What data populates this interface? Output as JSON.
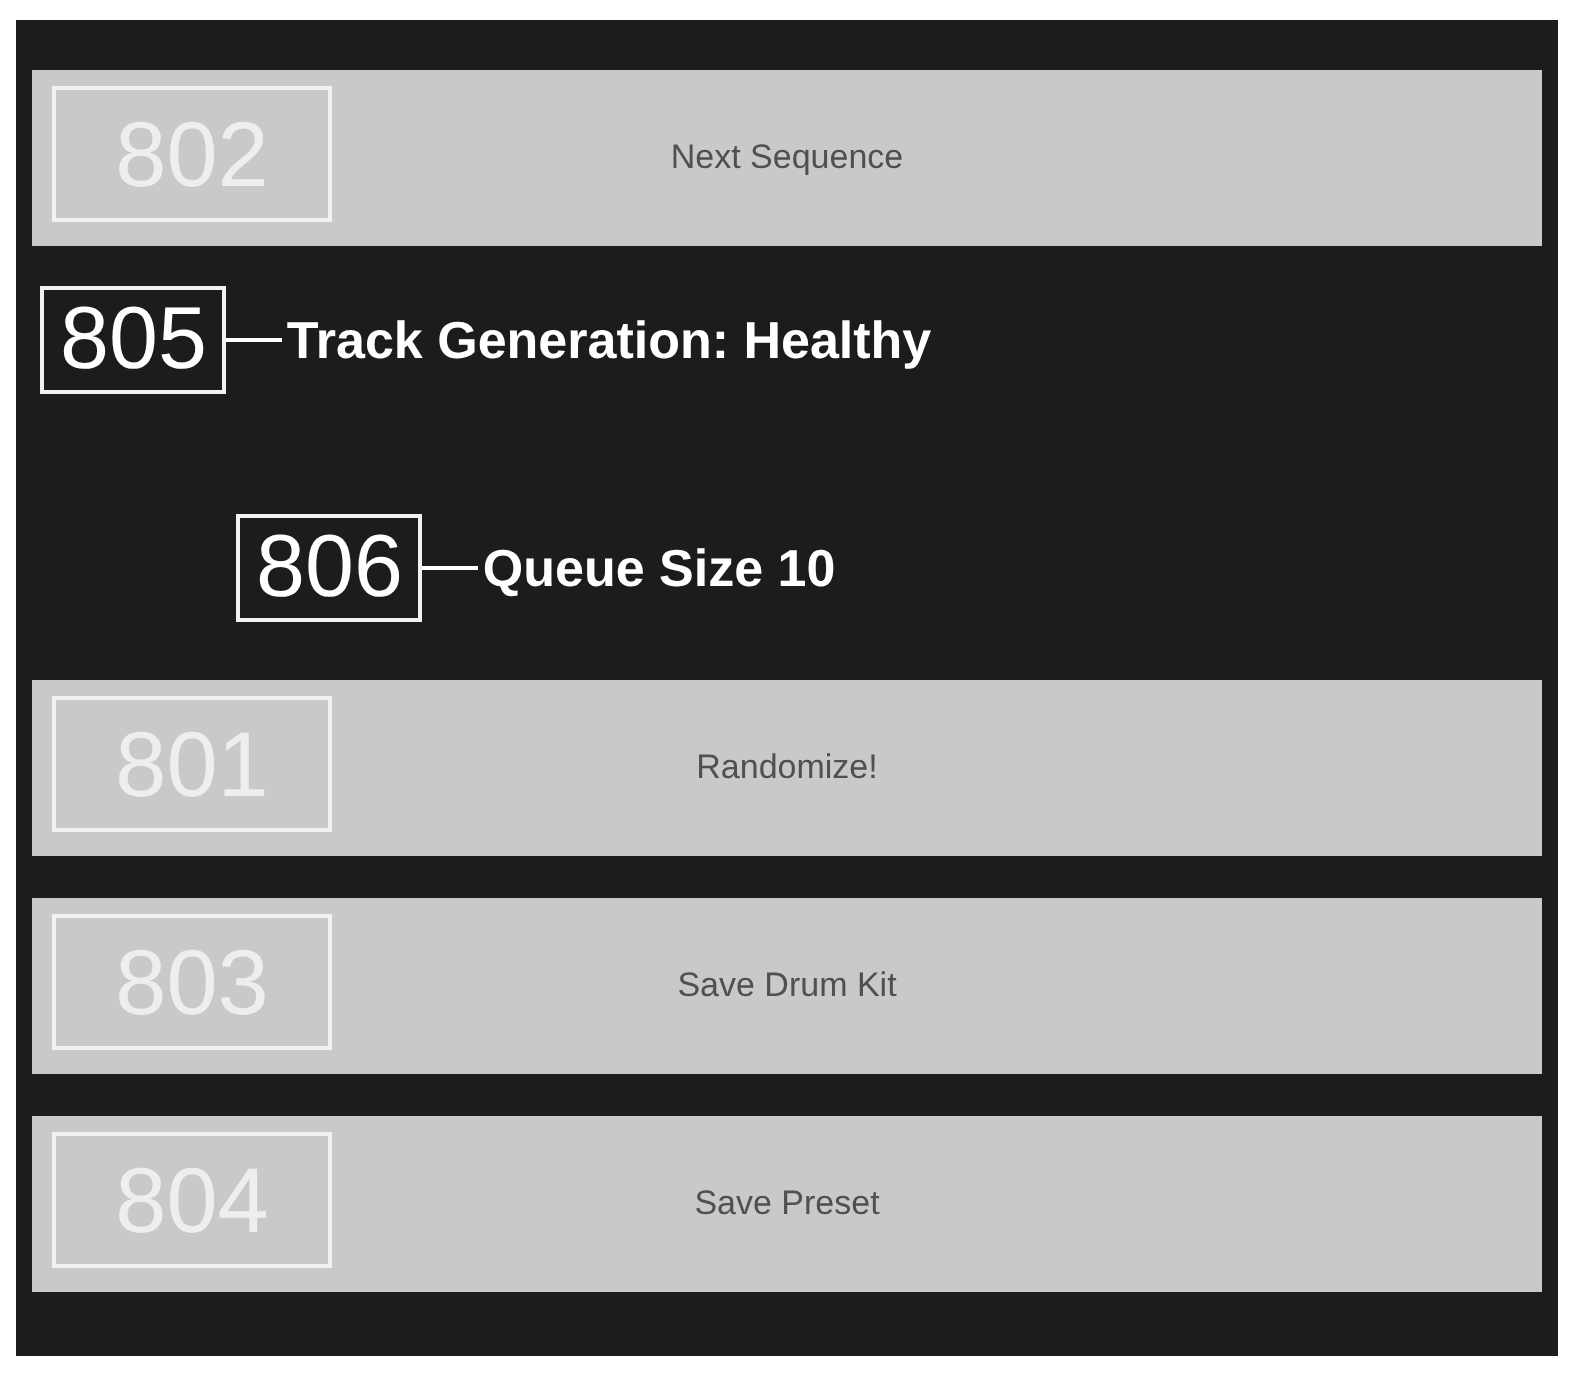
{
  "top_button": {
    "ref": "802",
    "label": "Next Sequence"
  },
  "status": [
    {
      "ref": "805",
      "text": "Track Generation: Healthy"
    },
    {
      "ref": "806",
      "text": "Queue Size 10"
    }
  ],
  "buttons": [
    {
      "ref": "801",
      "label": "Randomize!"
    },
    {
      "ref": "803",
      "label": "Save Drum Kit"
    },
    {
      "ref": "804",
      "label": "Save Preset"
    }
  ]
}
